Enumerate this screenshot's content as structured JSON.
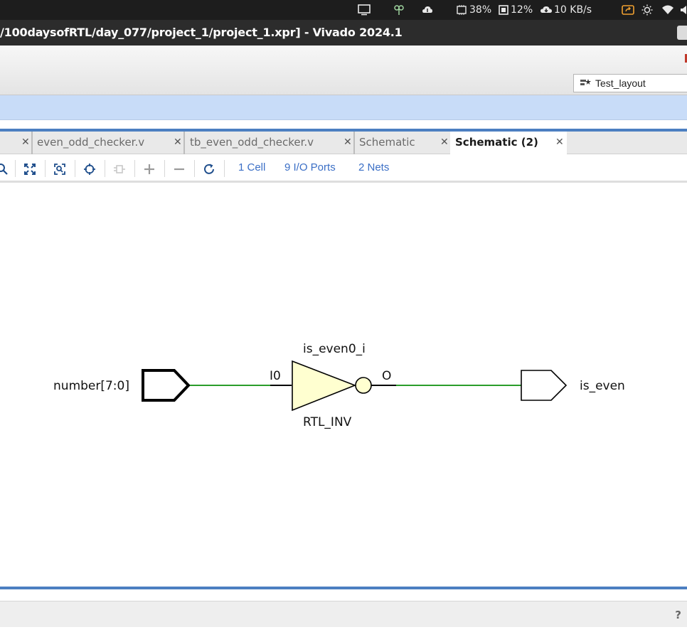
{
  "system_bar": {
    "cpu": "38%",
    "memory": "12%",
    "network": "10 KB/s"
  },
  "window": {
    "title": "/100daysofRTL/day_077/project_1/project_1.xpr] - Vivado 2024.1"
  },
  "toolbar": {
    "layout_selector": "Test_layout"
  },
  "tabs": [
    {
      "label": "even_odd_checker.v",
      "active": false
    },
    {
      "label": "tb_even_odd_checker.v",
      "active": false
    },
    {
      "label": "Schematic",
      "active": false
    },
    {
      "label": "Schematic (2)",
      "active": true
    }
  ],
  "schematic_toolbar": {
    "cells": "1 Cell",
    "io_ports": "9 I/O Ports",
    "nets": "2 Nets"
  },
  "schematic": {
    "input_port": "number[7:0]",
    "output_port": "is_even",
    "cell_instance": "is_even0_i",
    "cell_type": "RTL_INV",
    "pin_in": "I0",
    "pin_out": "O",
    "colors": {
      "wire": "#2a9d2a",
      "gate_fill": "#ffffd0",
      "accent": "#4c7fc1",
      "link": "#3b6fc6"
    }
  },
  "status": {
    "help": "?"
  }
}
